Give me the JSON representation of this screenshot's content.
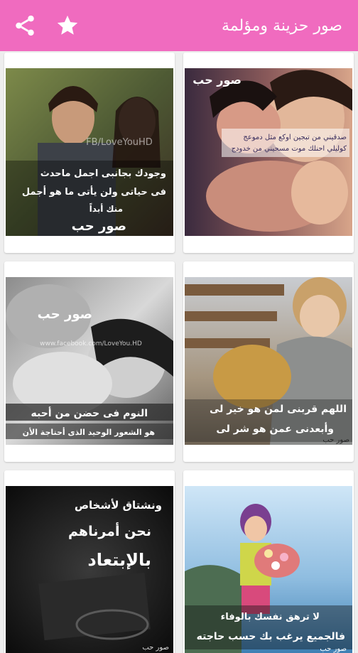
{
  "app": {
    "title": "صور حزينة ومؤلمة",
    "colors": {
      "appbar": "#f06bbf",
      "background": "#eeeeee"
    },
    "icons": {
      "share": "share-icon",
      "favorite": "star-icon"
    }
  },
  "cards": [
    {
      "watermark": "FB/LoveYouHD",
      "lines": [
        "وجودك بجانبى اجمل ماحدث",
        "فى حياتى ولن يأتى ما هو أجمل",
        "منك أبداً"
      ],
      "stamp": "صور حب"
    },
    {
      "stamp": "صور حب",
      "lines": [
        "صدقيني من تبجين اوكع مثل دموعج",
        "كوليلي احنلك موت مسحيني من خدودج"
      ]
    },
    {
      "stamp": "صور حب",
      "watermark": "www.facebook.com/LoveYou.HD",
      "lines": [
        "النوم فى حضن من أحبه",
        "هو الشعور الوحيد الذى أحتاجة الأن"
      ]
    },
    {
      "lines": [
        "اللهم قربنى لمن هو خير لى",
        "وأبعدنى عمن هو شر لى"
      ],
      "stamp": "صور حب"
    },
    {
      "lines": [
        "ونشتاق لأشخاص",
        "نحن أمرناهم",
        "بالإبتعاد"
      ],
      "stamp": "صور حب"
    },
    {
      "lines": [
        "لا ترهق نفسك بالوفاء",
        "فالجميع يرغب بك حسب حاجته"
      ],
      "stamp": "صور حب"
    }
  ]
}
